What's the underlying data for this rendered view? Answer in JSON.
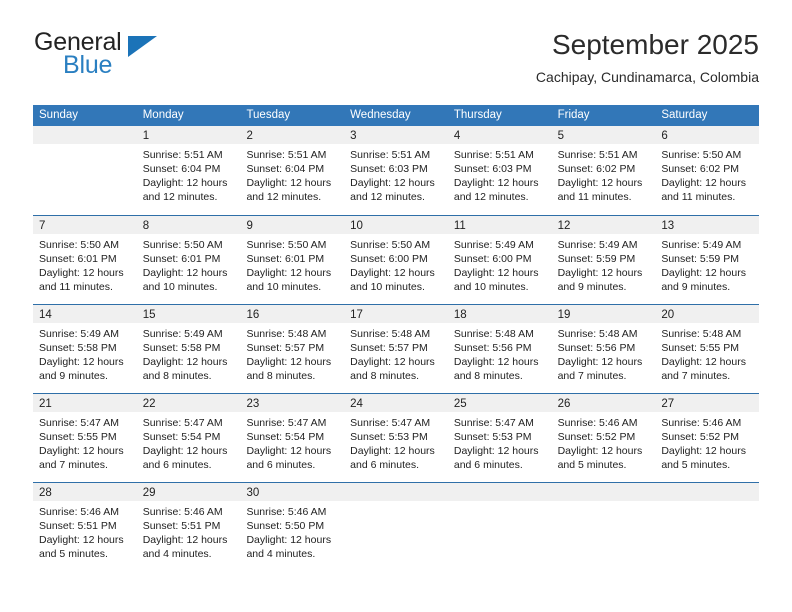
{
  "brand": {
    "word_one": "General",
    "word_two": "Blue",
    "triangle_icon": "blue-triangle-icon",
    "accent_color": "#2a7fc1"
  },
  "header": {
    "title": "September 2025",
    "subtitle": "Cachipay, Cundinamarca, Colombia"
  },
  "theme": {
    "header_blue": "#3277b8",
    "separator_blue": "#2f6fa8",
    "daynum_band": "#f0f0f0"
  },
  "calendar": {
    "weekdays": [
      "Sunday",
      "Monday",
      "Tuesday",
      "Wednesday",
      "Thursday",
      "Friday",
      "Saturday"
    ],
    "weeks": [
      [
        {
          "day": "",
          "lines": []
        },
        {
          "day": "1",
          "lines": [
            "Sunrise: 5:51 AM",
            "Sunset: 6:04 PM",
            "Daylight: 12 hours",
            "and 12 minutes."
          ]
        },
        {
          "day": "2",
          "lines": [
            "Sunrise: 5:51 AM",
            "Sunset: 6:04 PM",
            "Daylight: 12 hours",
            "and 12 minutes."
          ]
        },
        {
          "day": "3",
          "lines": [
            "Sunrise: 5:51 AM",
            "Sunset: 6:03 PM",
            "Daylight: 12 hours",
            "and 12 minutes."
          ]
        },
        {
          "day": "4",
          "lines": [
            "Sunrise: 5:51 AM",
            "Sunset: 6:03 PM",
            "Daylight: 12 hours",
            "and 12 minutes."
          ]
        },
        {
          "day": "5",
          "lines": [
            "Sunrise: 5:51 AM",
            "Sunset: 6:02 PM",
            "Daylight: 12 hours",
            "and 11 minutes."
          ]
        },
        {
          "day": "6",
          "lines": [
            "Sunrise: 5:50 AM",
            "Sunset: 6:02 PM",
            "Daylight: 12 hours",
            "and 11 minutes."
          ]
        }
      ],
      [
        {
          "day": "7",
          "lines": [
            "Sunrise: 5:50 AM",
            "Sunset: 6:01 PM",
            "Daylight: 12 hours",
            "and 11 minutes."
          ]
        },
        {
          "day": "8",
          "lines": [
            "Sunrise: 5:50 AM",
            "Sunset: 6:01 PM",
            "Daylight: 12 hours",
            "and 10 minutes."
          ]
        },
        {
          "day": "9",
          "lines": [
            "Sunrise: 5:50 AM",
            "Sunset: 6:01 PM",
            "Daylight: 12 hours",
            "and 10 minutes."
          ]
        },
        {
          "day": "10",
          "lines": [
            "Sunrise: 5:50 AM",
            "Sunset: 6:00 PM",
            "Daylight: 12 hours",
            "and 10 minutes."
          ]
        },
        {
          "day": "11",
          "lines": [
            "Sunrise: 5:49 AM",
            "Sunset: 6:00 PM",
            "Daylight: 12 hours",
            "and 10 minutes."
          ]
        },
        {
          "day": "12",
          "lines": [
            "Sunrise: 5:49 AM",
            "Sunset: 5:59 PM",
            "Daylight: 12 hours",
            "and 9 minutes."
          ]
        },
        {
          "day": "13",
          "lines": [
            "Sunrise: 5:49 AM",
            "Sunset: 5:59 PM",
            "Daylight: 12 hours",
            "and 9 minutes."
          ]
        }
      ],
      [
        {
          "day": "14",
          "lines": [
            "Sunrise: 5:49 AM",
            "Sunset: 5:58 PM",
            "Daylight: 12 hours",
            "and 9 minutes."
          ]
        },
        {
          "day": "15",
          "lines": [
            "Sunrise: 5:49 AM",
            "Sunset: 5:58 PM",
            "Daylight: 12 hours",
            "and 8 minutes."
          ]
        },
        {
          "day": "16",
          "lines": [
            "Sunrise: 5:48 AM",
            "Sunset: 5:57 PM",
            "Daylight: 12 hours",
            "and 8 minutes."
          ]
        },
        {
          "day": "17",
          "lines": [
            "Sunrise: 5:48 AM",
            "Sunset: 5:57 PM",
            "Daylight: 12 hours",
            "and 8 minutes."
          ]
        },
        {
          "day": "18",
          "lines": [
            "Sunrise: 5:48 AM",
            "Sunset: 5:56 PM",
            "Daylight: 12 hours",
            "and 8 minutes."
          ]
        },
        {
          "day": "19",
          "lines": [
            "Sunrise: 5:48 AM",
            "Sunset: 5:56 PM",
            "Daylight: 12 hours",
            "and 7 minutes."
          ]
        },
        {
          "day": "20",
          "lines": [
            "Sunrise: 5:48 AM",
            "Sunset: 5:55 PM",
            "Daylight: 12 hours",
            "and 7 minutes."
          ]
        }
      ],
      [
        {
          "day": "21",
          "lines": [
            "Sunrise: 5:47 AM",
            "Sunset: 5:55 PM",
            "Daylight: 12 hours",
            "and 7 minutes."
          ]
        },
        {
          "day": "22",
          "lines": [
            "Sunrise: 5:47 AM",
            "Sunset: 5:54 PM",
            "Daylight: 12 hours",
            "and 6 minutes."
          ]
        },
        {
          "day": "23",
          "lines": [
            "Sunrise: 5:47 AM",
            "Sunset: 5:54 PM",
            "Daylight: 12 hours",
            "and 6 minutes."
          ]
        },
        {
          "day": "24",
          "lines": [
            "Sunrise: 5:47 AM",
            "Sunset: 5:53 PM",
            "Daylight: 12 hours",
            "and 6 minutes."
          ]
        },
        {
          "day": "25",
          "lines": [
            "Sunrise: 5:47 AM",
            "Sunset: 5:53 PM",
            "Daylight: 12 hours",
            "and 6 minutes."
          ]
        },
        {
          "day": "26",
          "lines": [
            "Sunrise: 5:46 AM",
            "Sunset: 5:52 PM",
            "Daylight: 12 hours",
            "and 5 minutes."
          ]
        },
        {
          "day": "27",
          "lines": [
            "Sunrise: 5:46 AM",
            "Sunset: 5:52 PM",
            "Daylight: 12 hours",
            "and 5 minutes."
          ]
        }
      ],
      [
        {
          "day": "28",
          "lines": [
            "Sunrise: 5:46 AM",
            "Sunset: 5:51 PM",
            "Daylight: 12 hours",
            "and 5 minutes."
          ]
        },
        {
          "day": "29",
          "lines": [
            "Sunrise: 5:46 AM",
            "Sunset: 5:51 PM",
            "Daylight: 12 hours",
            "and 4 minutes."
          ]
        },
        {
          "day": "30",
          "lines": [
            "Sunrise: 5:46 AM",
            "Sunset: 5:50 PM",
            "Daylight: 12 hours",
            "and 4 minutes."
          ]
        },
        {
          "day": "",
          "lines": []
        },
        {
          "day": "",
          "lines": []
        },
        {
          "day": "",
          "lines": []
        },
        {
          "day": "",
          "lines": []
        }
      ]
    ]
  }
}
